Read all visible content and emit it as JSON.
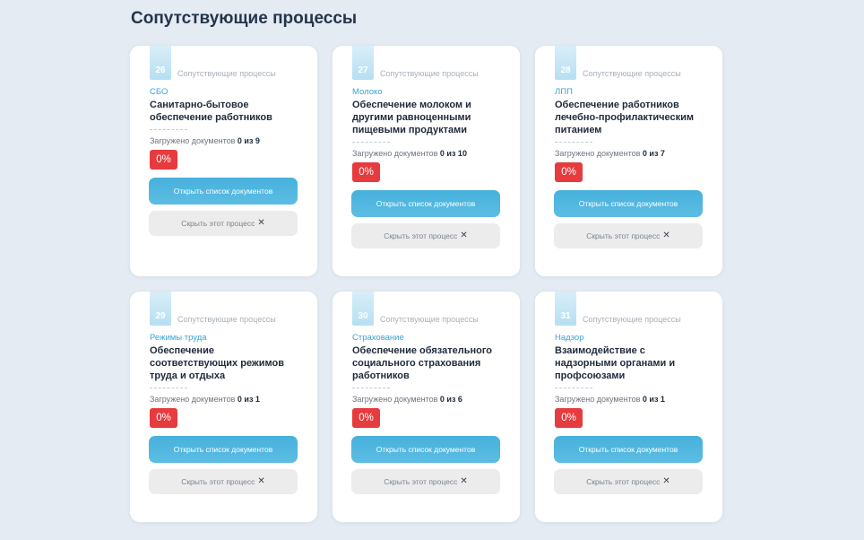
{
  "header": {
    "title": "Сопутствующие процессы"
  },
  "labels": {
    "process_label": "Сопутствующие процессы",
    "loaded_prefix": "Загружено документов",
    "open_button": "Открыть список документов",
    "hide_button": "Скрыть этот процесс"
  },
  "icons": {
    "close": "close-icon"
  },
  "colors": {
    "accent": "#47b1dc",
    "badge": "#e63b3f",
    "background": "#e4ebf3"
  },
  "cards": [
    {
      "number": "26",
      "code": "СБО",
      "title": "Санитарно-бытовое обеспечение работников",
      "loaded": "0 из 9",
      "percent": "0%"
    },
    {
      "number": "27",
      "code": "Молоко",
      "title": "Обеспечение молоком и другими равноценными пищевыми продуктами",
      "loaded": "0 из 10",
      "percent": "0%"
    },
    {
      "number": "28",
      "code": "ЛПП",
      "title": "Обеспечение работников лечебно-профилактическим питанием",
      "loaded": "0 из 7",
      "percent": "0%"
    },
    {
      "number": "29",
      "code": "Режимы труда",
      "title": "Обеспечение соответствующих режимов труда и отдыха",
      "loaded": "0 из 1",
      "percent": "0%"
    },
    {
      "number": "30",
      "code": "Страхование",
      "title": "Обеспечение обязательного социального страхования работников",
      "loaded": "0 из 6",
      "percent": "0%"
    },
    {
      "number": "31",
      "code": "Надзор",
      "title": "Взаимодействие с надзорными органами и профсоюзами",
      "loaded": "0 из 1",
      "percent": "0%"
    }
  ]
}
